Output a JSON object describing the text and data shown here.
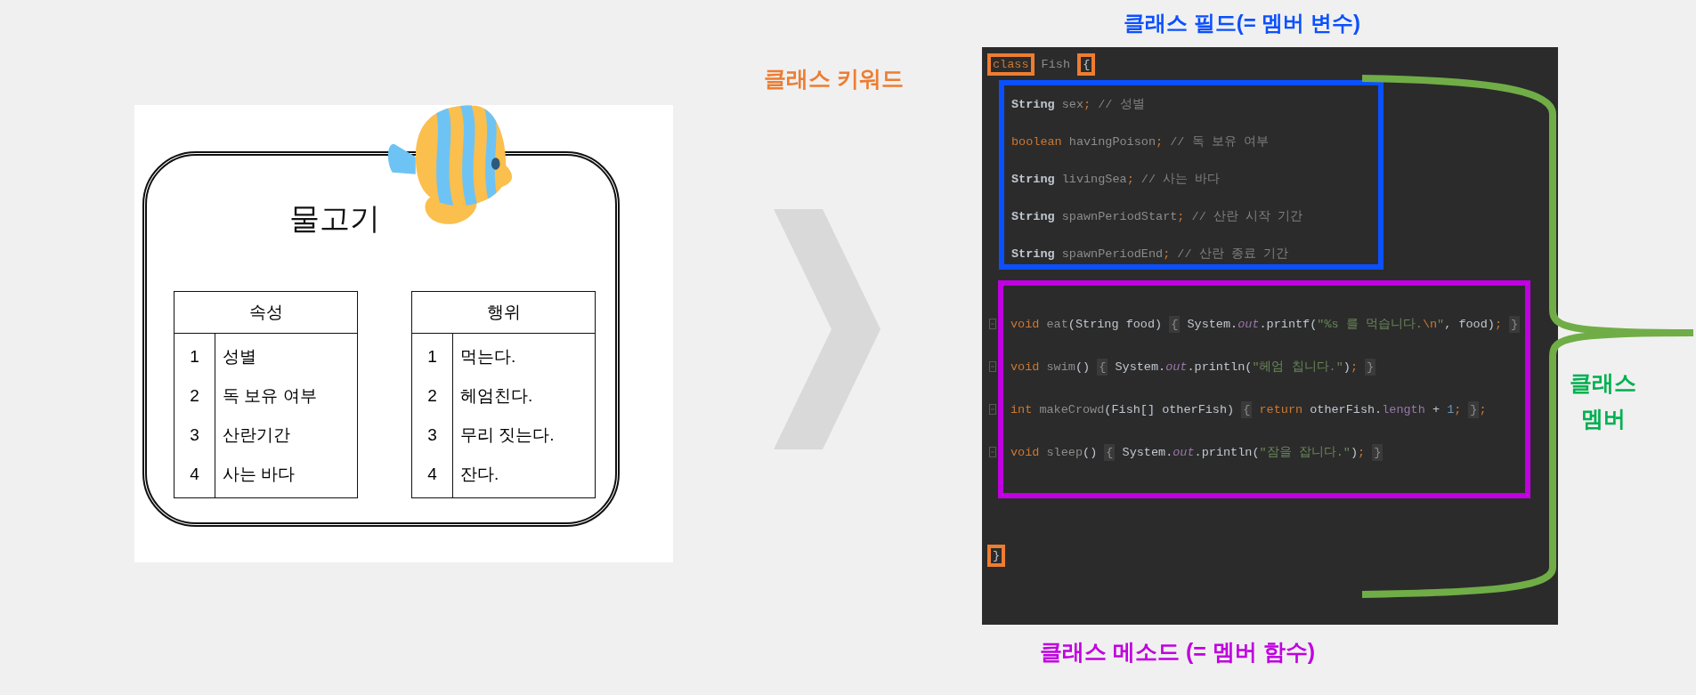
{
  "diagram": {
    "title": "물고기",
    "tables": [
      {
        "heading": "속성",
        "rows": [
          {
            "number": "1",
            "text": "성별"
          },
          {
            "number": "2",
            "text": "독 보유 여부"
          },
          {
            "number": "3",
            "text": "산란기간"
          },
          {
            "number": "4",
            "text": "사는 바다"
          }
        ]
      },
      {
        "heading": "행위",
        "rows": [
          {
            "number": "1",
            "text": "먹는다."
          },
          {
            "number": "2",
            "text": "헤엄친다."
          },
          {
            "number": "3",
            "text": "무리 짓는다."
          },
          {
            "number": "4",
            "text": "잔다."
          }
        ]
      }
    ]
  },
  "code_editor": {
    "header": [
      {
        "text": "class",
        "kind": "keyword",
        "highlighted": true
      },
      {
        "text": " Fish ",
        "kind": "name",
        "highlighted": false
      },
      {
        "text": "{",
        "kind": "plain",
        "highlighted": true
      }
    ],
    "fields": [
      {
        "tokens": [
          {
            "text": "String ",
            "kind": "type",
            "highlighted": false
          },
          {
            "text": "sex",
            "kind": "name",
            "highlighted": false
          },
          {
            "text": ";",
            "kind": "punct",
            "highlighted": false
          },
          {
            "text": " // 성별",
            "kind": "comment",
            "highlighted": false
          }
        ]
      },
      {
        "tokens": [
          {
            "text": "boolean ",
            "kind": "keyword",
            "highlighted": false
          },
          {
            "text": "havingPoison",
            "kind": "name",
            "highlighted": false
          },
          {
            "text": ";",
            "kind": "punct",
            "highlighted": false
          },
          {
            "text": " // 독 보유 여부",
            "kind": "comment",
            "highlighted": false
          }
        ]
      },
      {
        "tokens": [
          {
            "text": "String ",
            "kind": "type",
            "highlighted": false
          },
          {
            "text": "livingSea",
            "kind": "name",
            "highlighted": false
          },
          {
            "text": ";",
            "kind": "punct",
            "highlighted": false
          },
          {
            "text": " // 사는 바다",
            "kind": "comment",
            "highlighted": false
          }
        ]
      },
      {
        "tokens": [
          {
            "text": "String ",
            "kind": "type",
            "highlighted": false
          },
          {
            "text": "spawnPeriodStart",
            "kind": "name",
            "highlighted": false
          },
          {
            "text": ";",
            "kind": "punct",
            "highlighted": false
          },
          {
            "text": " // 산란 시작 기간",
            "kind": "comment",
            "highlighted": false
          }
        ]
      },
      {
        "tokens": [
          {
            "text": "String ",
            "kind": "type",
            "highlighted": false
          },
          {
            "text": "spawnPeriodEnd",
            "kind": "name",
            "highlighted": false
          },
          {
            "text": ";",
            "kind": "punct",
            "highlighted": false
          },
          {
            "text": " // 산란 종료 기간",
            "kind": "comment",
            "highlighted": false
          }
        ]
      }
    ],
    "methods": [
      {
        "foldable": true,
        "tokens": [
          {
            "text": "void ",
            "kind": "keyword",
            "highlighted": false
          },
          {
            "text": "eat",
            "kind": "name",
            "highlighted": false
          },
          {
            "text": "(String food) ",
            "kind": "plain",
            "highlighted": false
          },
          {
            "text": "{",
            "kind": "brace",
            "highlighted": false
          },
          {
            "text": " System.",
            "kind": "plain",
            "highlighted": false
          },
          {
            "text": "out",
            "kind": "static",
            "highlighted": false
          },
          {
            "text": ".printf(",
            "kind": "plain",
            "highlighted": false
          },
          {
            "text": "\"%s 를 먹습니다.",
            "kind": "string",
            "highlighted": false
          },
          {
            "text": "\\n",
            "kind": "keyword",
            "highlighted": false
          },
          {
            "text": "\"",
            "kind": "string",
            "highlighted": false
          },
          {
            "text": ", food)",
            "kind": "plain",
            "highlighted": false
          },
          {
            "text": ";",
            "kind": "punct",
            "highlighted": false
          },
          {
            "text": "}",
            "kind": "brace",
            "highlighted": false
          }
        ]
      },
      {
        "foldable": true,
        "tokens": [
          {
            "text": "void ",
            "kind": "keyword",
            "highlighted": false
          },
          {
            "text": "swim",
            "kind": "name",
            "highlighted": false
          },
          {
            "text": "() ",
            "kind": "plain",
            "highlighted": false
          },
          {
            "text": "{",
            "kind": "brace",
            "highlighted": false
          },
          {
            "text": " System.",
            "kind": "plain",
            "highlighted": false
          },
          {
            "text": "out",
            "kind": "static",
            "highlighted": false
          },
          {
            "text": ".println(",
            "kind": "plain",
            "highlighted": false
          },
          {
            "text": "\"헤엄 칩니다.\"",
            "kind": "string",
            "highlighted": false
          },
          {
            "text": ")",
            "kind": "plain",
            "highlighted": false
          },
          {
            "text": ";",
            "kind": "punct",
            "highlighted": false
          },
          {
            "text": "}",
            "kind": "brace",
            "highlighted": false
          }
        ]
      },
      {
        "foldable": true,
        "tokens": [
          {
            "text": "int ",
            "kind": "keyword",
            "highlighted": false
          },
          {
            "text": "makeCrowd",
            "kind": "name",
            "highlighted": false
          },
          {
            "text": "(Fish[] otherFish) ",
            "kind": "plain",
            "highlighted": false
          },
          {
            "text": "{",
            "kind": "brace",
            "highlighted": false
          },
          {
            "text": " return ",
            "kind": "keyword",
            "highlighted": false
          },
          {
            "text": "otherFish.",
            "kind": "plain",
            "highlighted": false
          },
          {
            "text": "length",
            "kind": "field",
            "highlighted": false
          },
          {
            "text": " + ",
            "kind": "plain",
            "highlighted": false
          },
          {
            "text": "1",
            "kind": "number",
            "highlighted": false
          },
          {
            "text": ";",
            "kind": "punct",
            "highlighted": false
          },
          {
            "text": "}",
            "kind": "brace",
            "highlighted": false
          },
          {
            "text": ";",
            "kind": "punct",
            "highlighted": false
          }
        ]
      },
      {
        "foldable": true,
        "tokens": [
          {
            "text": "void ",
            "kind": "keyword",
            "highlighted": false
          },
          {
            "text": "sleep",
            "kind": "name",
            "highlighted": false
          },
          {
            "text": "() ",
            "kind": "plain",
            "highlighted": false
          },
          {
            "text": "{",
            "kind": "brace",
            "highlighted": false
          },
          {
            "text": " System.",
            "kind": "plain",
            "highlighted": false
          },
          {
            "text": "out",
            "kind": "static",
            "highlighted": false
          },
          {
            "text": ".println(",
            "kind": "plain",
            "highlighted": false
          },
          {
            "text": "\"잠을 잡니다.\"",
            "kind": "string",
            "highlighted": false
          },
          {
            "text": ")",
            "kind": "plain",
            "highlighted": false
          },
          {
            "text": ";",
            "kind": "punct",
            "highlighted": false
          },
          {
            "text": "}",
            "kind": "brace",
            "highlighted": false
          }
        ]
      }
    ],
    "footer": [
      {
        "text": "}",
        "kind": "plain",
        "highlighted": true
      }
    ]
  },
  "annotations": {
    "class_field": "클래스 필드(= 멤버 변수)",
    "class_keyword": "클래스 키워드",
    "class_member": [
      "클래스",
      "멤버"
    ],
    "class_method": "클래스 메소드 (= 멤버 함수)"
  }
}
